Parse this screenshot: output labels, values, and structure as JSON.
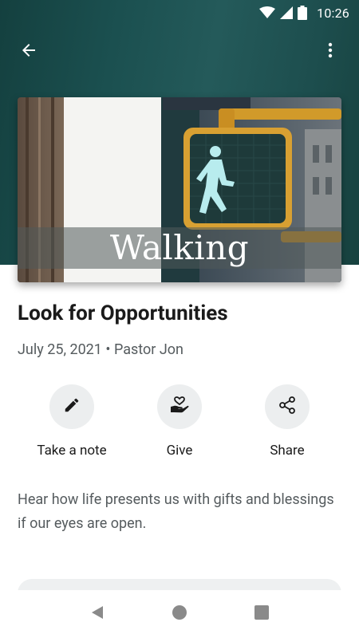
{
  "status_bar": {
    "time": "10:26",
    "icons": [
      "wifi-icon",
      "cellular-signal-icon",
      "battery-icon"
    ]
  },
  "app_bar": {
    "back_icon": "arrow-back-icon",
    "menu_icon": "more-vertical-icon"
  },
  "hero": {
    "series_title": "Walking",
    "image": "pedestrian-walk-signal-photo"
  },
  "sermon": {
    "title": "Look for Opportunities",
    "date": "July 25, 2021",
    "separator": "•",
    "speaker": "Pastor Jon",
    "description": "Hear how life presents us with gifts and blessings if our eyes are open."
  },
  "actions": [
    {
      "label": "Take a note",
      "icon": "pencil-icon"
    },
    {
      "label": "Give",
      "icon": "heart-hand-icon"
    },
    {
      "label": "Share",
      "icon": "share-icon"
    }
  ],
  "nav_bar": {
    "icons": [
      "nav-back-icon",
      "nav-home-icon",
      "nav-recents-icon"
    ]
  },
  "colors": {
    "header_bg": "#1b4f4f",
    "action_circle": "#eceeef",
    "meta_text": "#555b5e"
  }
}
